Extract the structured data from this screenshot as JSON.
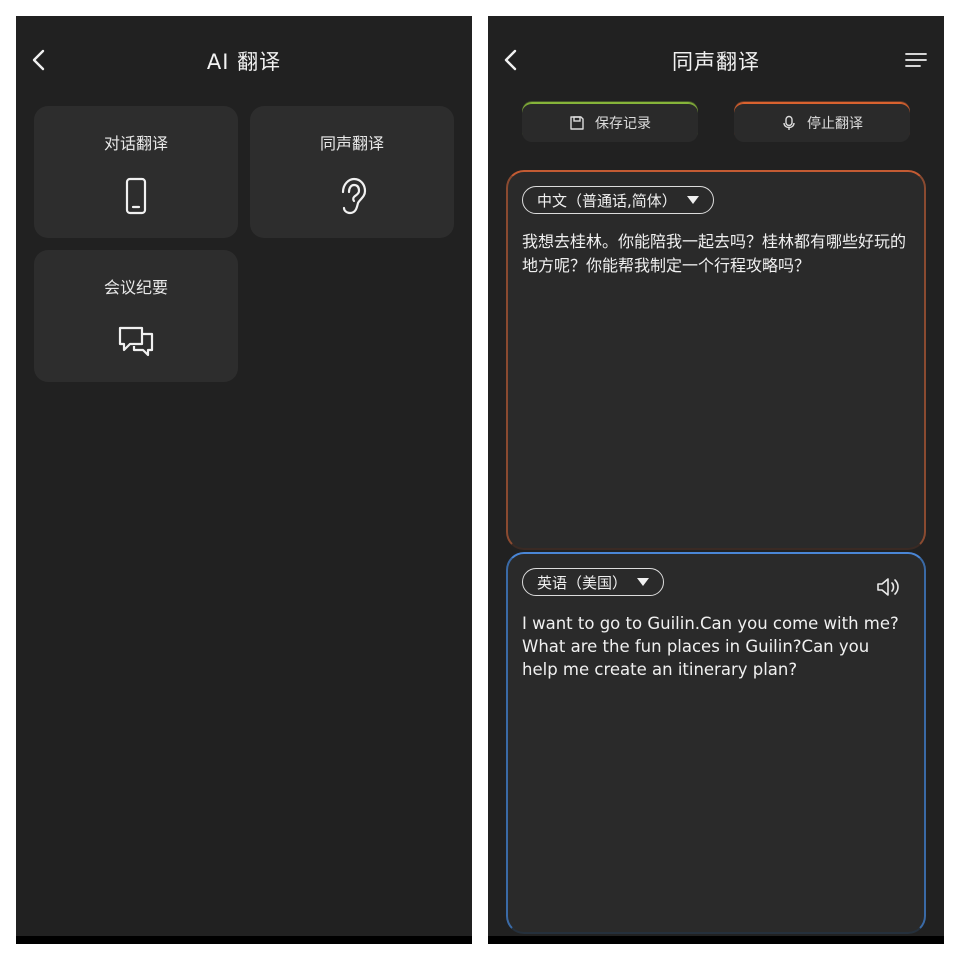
{
  "left_screen": {
    "title": "AI 翻译",
    "tiles": [
      {
        "label": "对话翻译",
        "icon": "phone-icon"
      },
      {
        "label": "同声翻译",
        "icon": "ear-icon"
      },
      {
        "label": "会议纪要",
        "icon": "chat-bubbles-icon"
      }
    ]
  },
  "right_screen": {
    "title": "同声翻译",
    "buttons": {
      "save_label": "保存记录",
      "stop_label": "停止翻译"
    },
    "source": {
      "language": "中文（普通话,简体）",
      "text": "我想去桂林。你能陪我一起去吗？桂林都有哪些好玩的地方呢？你能帮我制定一个行程攻略吗？"
    },
    "target": {
      "language": "英语（美国）",
      "text": "I want to go to Guilin.Can you come with me? What are the fun places in Guilin?Can you help me create an itinerary plan?"
    }
  },
  "colors": {
    "background": "#212121",
    "tile": "#2d2d2d",
    "save_accent": "#86b43a",
    "stop_accent": "#d9622f",
    "source_border": "#c35b33",
    "target_border": "#4a86d6"
  }
}
